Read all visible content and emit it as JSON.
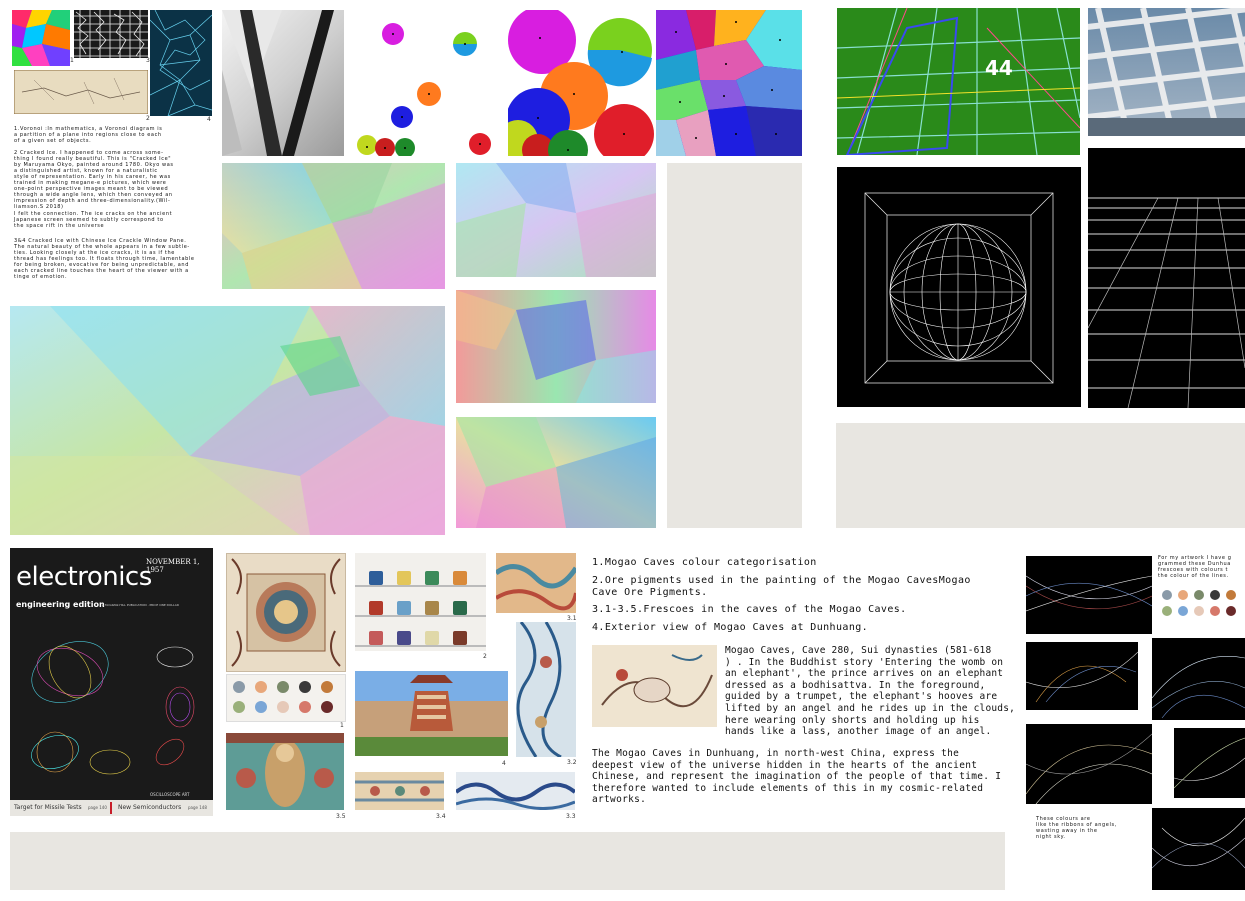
{
  "left_notes": {
    "para1": "1.Voronoi :In mathematics, a Voronoi diagram is\na partition of a plane into regions close to each\nof a given set of objects.",
    "para2": "2 Cracked Ice. I happened to come across some-\nthing I found really beautiful. This is \"Cracked Ice\"\nby Maruyama Okyo, painted around 1780. Okyo was\na distinguished artist, known for a naturalistic\nstyle of representation. Early in his career, he was\ntrained in making megane-e pictures, which were\none-point perspective images meant to be viewed\nthrough a wide angle lens, which then conveyed an\nimpression of depth and three-dimensionality.(Wil-\nliamson.S 2018)",
    "para3": "I felt the connection. The ice cracks on the ancient\nJapanese screen seemed to subtly correspond to\nthe space rift in the universe",
    "para4": "3&4 Cracked Ice with Chinese Ice Crackle Window Pane.\nThe natural beauty of the whole appears in a few subtle-\nties. Looking closely at the ice cracks, it is as if the\nthread has feelings too. It floats through time, lamentable\nfor being broken, evocative for being unpredictable, and\neach cracked line touches the heart of the viewer with a\ntinge of emotion."
  },
  "thumb_numbers": {
    "n1": "1",
    "n3": "3",
    "n2": "2",
    "n4": "4"
  },
  "grid_number": "44",
  "magazine": {
    "title": "electronics",
    "date": "NOVEMBER 1, 1957",
    "edition": "engineering edition",
    "publisher": "A McGRAW-HILL PUBLICATION . PRICE ONE DOLLAR",
    "art_label": "OSCILLOSCOPE ART",
    "footer_left": "Target for Missile Tests",
    "footer_left_page": "page 140",
    "footer_right": "New Semiconductors",
    "footer_right_page": "page 148"
  },
  "collage_numbers": {
    "c1": "1",
    "c2": "2",
    "c31": "3.1",
    "c32": "3.2",
    "c33": "3.3",
    "c34": "3.4",
    "c35": "3.5",
    "c4": "4"
  },
  "mogao": {
    "list1": "1.Mogao Caves colour categorisation",
    "list2": "2.Ore pigments used in the painting of the Mogao CavesMogao\nCave Ore Pigments.",
    "list3": "3.1-3.5.Frescoes in the caves of the Mogao Caves.",
    "list4": "4.Exterior view of Mogao Caves at Dunhuang.",
    "cave_caption": "Mogao Caves, Cave 280, Sui dynasties (581-618\n) . In the Buddhist story 'Entering the womb on\nan elephant', the prince arrives on an elephant\ndressed as a bodhisattva. In the foreground,\nguided by a trumpet, the elephant's hooves are\nlifted by an angel and he rides up in the clouds,\nhere wearing only shorts and holding up his\nhands like a lass, another image of an angel.",
    "summary": "The Mogao Caves in Dunhuang, in north-west China, express the\ndeepest view of the universe hidden in the hearts of the ancient\nChinese, and represent the imagination of the people of that time. I\ntherefore wanted to include elements of this in my cosmic-related\nartworks."
  },
  "right_notes": {
    "top": "For my artwork I have g\ngrammed these Dunhua\nfrescoes with colours t\nthe colour of the lines.",
    "bottom": "These colours are\nlike the ribbons of angels,\nwasting away in the\nnight sky."
  },
  "palette_colors": [
    "#8a9aa8",
    "#e8a77a",
    "#7a8a6a",
    "#3a3a3a",
    "#c27a3a",
    "#9ab07a",
    "#7aa6d6",
    "#e6c9b8",
    "#d6786a",
    "#6a2a2a"
  ],
  "pigment_colors": [
    "#2e5e9a",
    "#e3c65a",
    "#3c8a5a",
    "#d98a3a",
    "#b23a2a",
    "#6aa0c8",
    "#a8864a",
    "#2a6a4a",
    "#c45a5a",
    "#4a4a8a",
    "#e0d8a8",
    "#7a3a2a"
  ]
}
